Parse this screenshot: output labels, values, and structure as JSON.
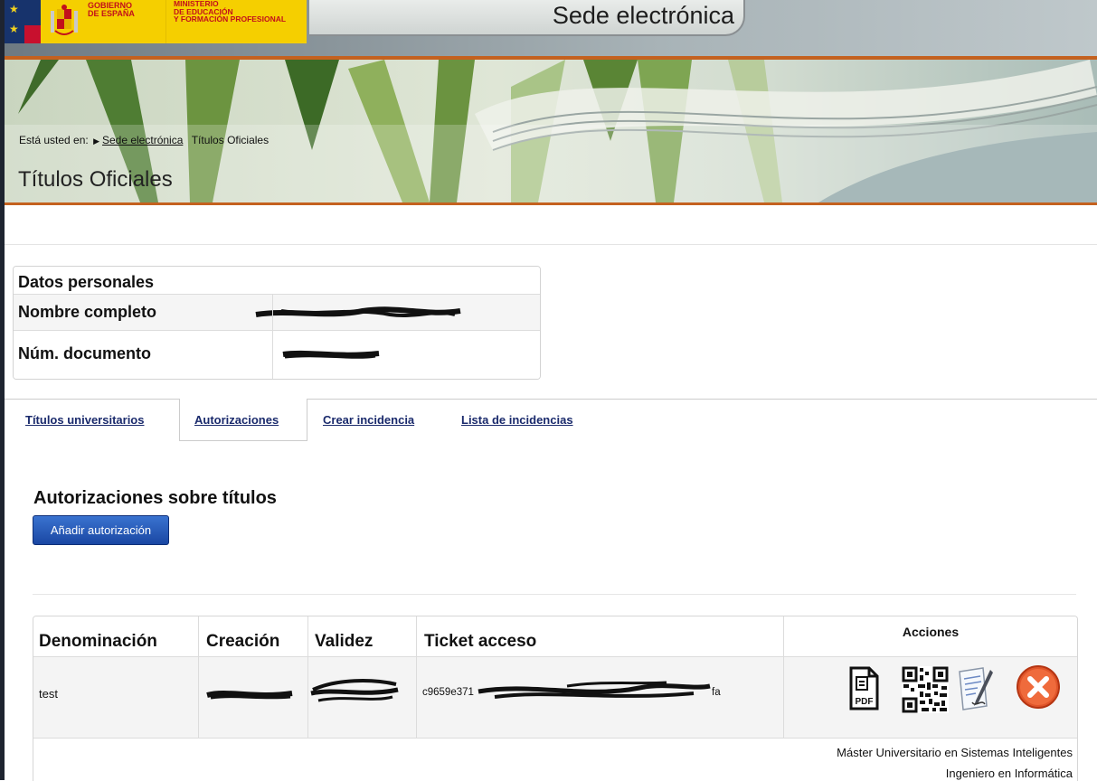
{
  "header": {
    "gov_line1": "GOBIERNO\nDE ESPAÑA",
    "ministry": "MINISTERIO\nDE EDUCACIÓN\nY FORMACIÓN PROFESIONAL",
    "site_title": "Sede electrónica"
  },
  "breadcrumb": {
    "prefix": "Está usted en:",
    "link": "Sede electrónica",
    "current": "Títulos Oficiales"
  },
  "page_title": "Títulos Oficiales",
  "personal": {
    "heading": "Datos personales",
    "name_label": "Nombre completo",
    "doc_label": "Núm. documento"
  },
  "tabs": [
    {
      "label": "Títulos universitarios",
      "active": false
    },
    {
      "label": "Autorizaciones",
      "active": true
    },
    {
      "label": "Crear incidencia",
      "active": false
    },
    {
      "label": "Lista de incidencias",
      "active": false
    }
  ],
  "authorizations": {
    "title": "Autorizaciones sobre títulos",
    "add_button": "Añadir autorización",
    "columns": [
      "Denominación",
      "Creación",
      "Validez",
      "Ticket acceso",
      "Acciones"
    ],
    "rows": [
      {
        "denominacion": "test",
        "ticket_visible": "c9659e371",
        "ticket_visible_end": "fa",
        "actions": [
          "pdf-icon",
          "qr-code-icon",
          "edit-document-icon",
          "delete-icon"
        ]
      }
    ],
    "titles": [
      "Máster Universitario en Sistemas Inteligentes",
      "Ingeniero en Informática"
    ]
  },
  "colors": {
    "accent_orange": "#c4611f",
    "button_blue": "#1a47a3",
    "tab_link": "#1a2a6c",
    "gov_yellow": "#f5cf00",
    "gov_red": "#c2101b"
  }
}
